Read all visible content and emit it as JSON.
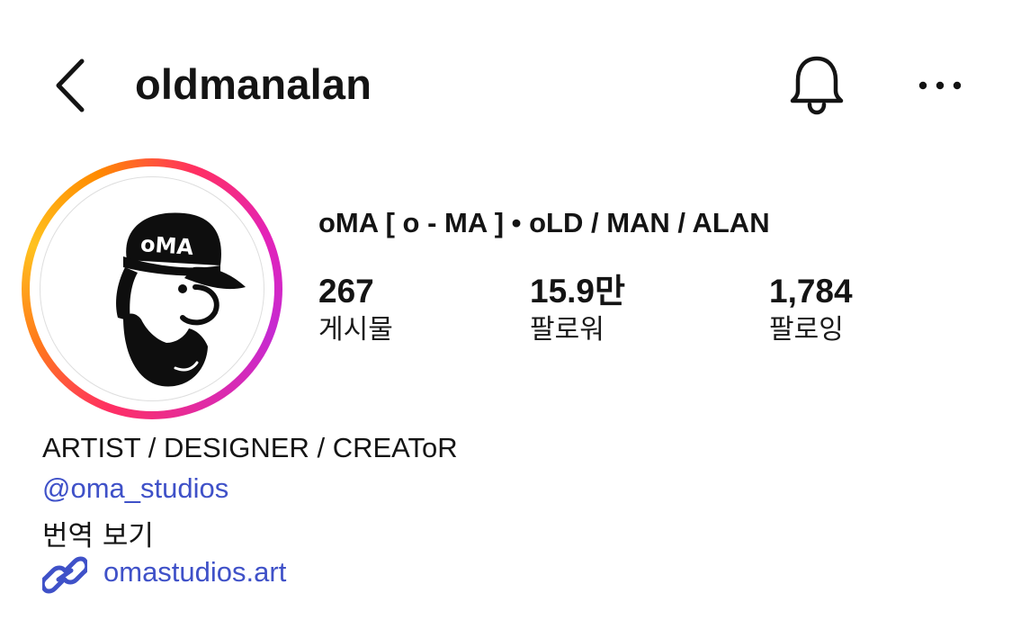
{
  "header": {
    "username": "oldmanalan",
    "back_icon": "chevron-left-icon",
    "bell_icon": "bell-icon",
    "more_icon": "more-horizontal-icon"
  },
  "profile": {
    "avatar_icon": "oma-cap-character-avatar",
    "avatar_cap_text": "oMA",
    "display_name": "oMA [ o - MA ] • oLD / MAN / ALAN",
    "ring_colors": [
      "#ff2f62",
      "#ff7a1a",
      "#ffc21f",
      "#c62ad1"
    ]
  },
  "stats": [
    {
      "value": "267",
      "label": "게시물"
    },
    {
      "value": "15.9만",
      "label": "팔로워"
    },
    {
      "value": "1,784",
      "label": "팔로잉"
    }
  ],
  "bio": {
    "text": "ARTIST / DESIGNER / CREAToR",
    "mention": "@oma_studios",
    "translate": "번역 보기",
    "link_icon": "link-icon",
    "link": "omastudios.art",
    "link_color": "#3f51c8"
  }
}
